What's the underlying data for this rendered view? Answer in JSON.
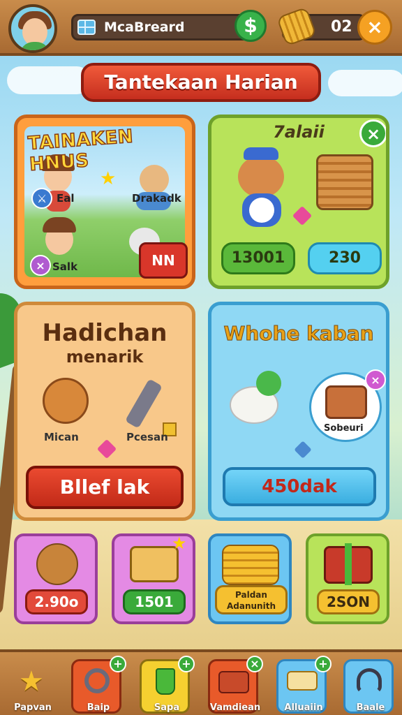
{
  "header": {
    "player_name": "McaBreard",
    "coins": "02",
    "cash_icon": "$",
    "close_icon": "×"
  },
  "banner": {
    "title": "Tantekaan Harian"
  },
  "cards": {
    "quest": {
      "title": "TAINAKEN HNUS",
      "labels": [
        "Eal",
        "Drakadk",
        "Salk"
      ],
      "button": "NN"
    },
    "character": {
      "title": "7alaii",
      "price_green": "13001",
      "price_blue": "230"
    },
    "gift": {
      "title_line1": "Hadichan",
      "title_line2": "menarik",
      "item1": "Mican",
      "item2": "Pcesan",
      "button": "Bllef lak"
    },
    "pet": {
      "title": "Whohe kaban",
      "chest_label": "Sobeuri",
      "button": "450dak"
    }
  },
  "shop": [
    {
      "price": "2.90o",
      "color": "#e24a3a"
    },
    {
      "price": "1501",
      "color": "#3aaa3a"
    },
    {
      "price": "Paldan Adanunith",
      "color": "#f5c030"
    },
    {
      "price": "2SON",
      "color": "#f5c030"
    }
  ],
  "nav": [
    {
      "label": "Papvan",
      "icon": "star-icon"
    },
    {
      "label": "Baip",
      "icon": "ring-icon"
    },
    {
      "label": "Sapa",
      "icon": "bucket-icon"
    },
    {
      "label": "Vamdiean",
      "icon": "case-icon"
    },
    {
      "label": "Alluaiin",
      "icon": "scroll-icon"
    },
    {
      "label": "Baale",
      "icon": "headset-icon"
    }
  ]
}
